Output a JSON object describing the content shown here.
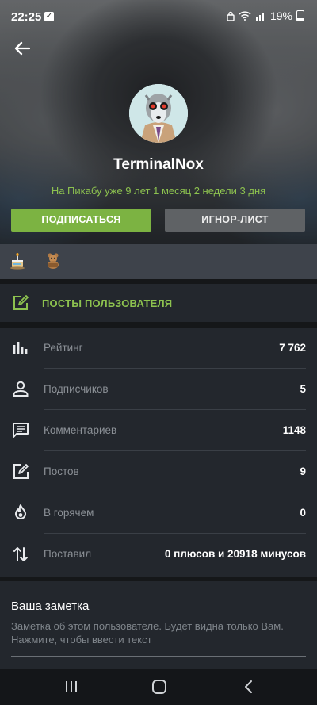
{
  "status_bar": {
    "time": "22:25",
    "battery": "19%"
  },
  "profile": {
    "username": "TerminalNox",
    "since": "На Пикабу уже 9 лет 1 месяц 2 недели 3 дня"
  },
  "buttons": {
    "subscribe": "ПОДПИСАТЬСЯ",
    "ignore": "ИГНОР-ЛИСТ"
  },
  "posts_link": "ПОСТЫ ПОЛЬЗОВАТЕЛЯ",
  "stats": [
    {
      "label": "Рейтинг",
      "value": "7 762",
      "icon": "bar-chart-icon"
    },
    {
      "label": "Подписчиков",
      "value": "5",
      "icon": "person-icon"
    },
    {
      "label": "Комментариев",
      "value": "1148",
      "icon": "comment-icon"
    },
    {
      "label": "Постов",
      "value": "9",
      "icon": "edit-icon"
    },
    {
      "label": "В горячем",
      "value": "0",
      "icon": "flame-icon"
    },
    {
      "label": "Поставил",
      "value": "0 плюсов и 20918 минусов",
      "icon": "arrows-icon"
    }
  ],
  "note": {
    "title": "Ваша заметка",
    "hint": "Заметка об этом пользователе. Будет видна только Вам. Нажмите, чтобы ввести текст"
  },
  "colors": {
    "accent": "#8dc24f",
    "button_green": "#7cb342",
    "panel": "#23272d"
  }
}
